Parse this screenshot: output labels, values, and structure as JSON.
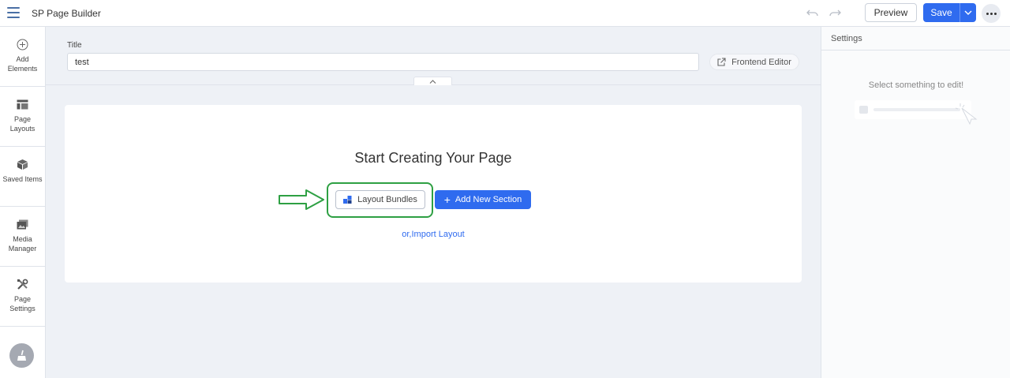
{
  "app": {
    "title": "SP Page Builder"
  },
  "toolbar": {
    "preview_label": "Preview",
    "save_label": "Save",
    "accent_color": "#2f6bef"
  },
  "sidebar": {
    "items": [
      {
        "label": "Add Elements",
        "icon": "plus-circle-icon"
      },
      {
        "label": "Page Layouts",
        "icon": "layout-icon"
      },
      {
        "label": "Saved Items",
        "icon": "box-icon"
      },
      {
        "label": "Media Manager",
        "icon": "images-icon"
      },
      {
        "label": "Page Settings",
        "icon": "tools-icon"
      }
    ]
  },
  "title_field": {
    "label": "Title",
    "value": "test"
  },
  "frontend_editor": {
    "label": "Frontend Editor"
  },
  "canvas": {
    "heading": "Start Creating Your Page",
    "layout_bundles_label": "Layout Bundles",
    "add_section_label": "Add New Section",
    "import_prefix": "or,",
    "import_link": "Import Layout",
    "highlight_color": "#2ea043"
  },
  "settings": {
    "title": "Settings",
    "empty_text": "Select something to edit!"
  }
}
